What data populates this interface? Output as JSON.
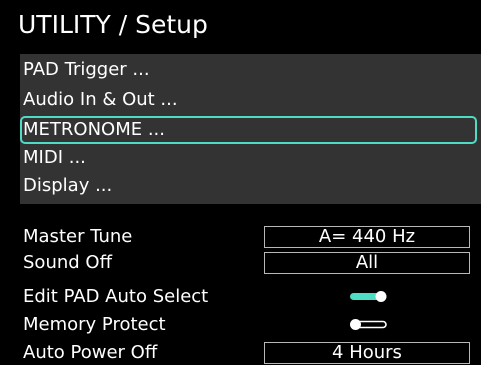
{
  "header": {
    "title": "UTILITY / Setup"
  },
  "menu": {
    "items": [
      {
        "label": "PAD Trigger ...",
        "selected": false
      },
      {
        "label": "Audio In & Out ...",
        "selected": false
      },
      {
        "label": "METRONOME ...",
        "selected": true
      },
      {
        "label": "MIDI ...",
        "selected": false
      },
      {
        "label": "Display ...",
        "selected": false
      }
    ]
  },
  "settings": {
    "master_tune": {
      "label": "Master Tune",
      "value": "A= 440 Hz"
    },
    "sound_off": {
      "label": "Sound Off",
      "value": "All"
    },
    "edit_pad_auto_select": {
      "label": "Edit PAD Auto Select",
      "state": "on"
    },
    "memory_protect": {
      "label": "Memory Protect",
      "state": "off"
    },
    "auto_power_off": {
      "label": "Auto Power Off",
      "value": "4 Hours"
    }
  },
  "colors": {
    "background": "#000000",
    "menu_background": "#333333",
    "selection_outline": "#4fdcc4",
    "toggle_on": "#4fdcc4",
    "value_border": "#b8b8b8",
    "text": "#ffffff"
  }
}
